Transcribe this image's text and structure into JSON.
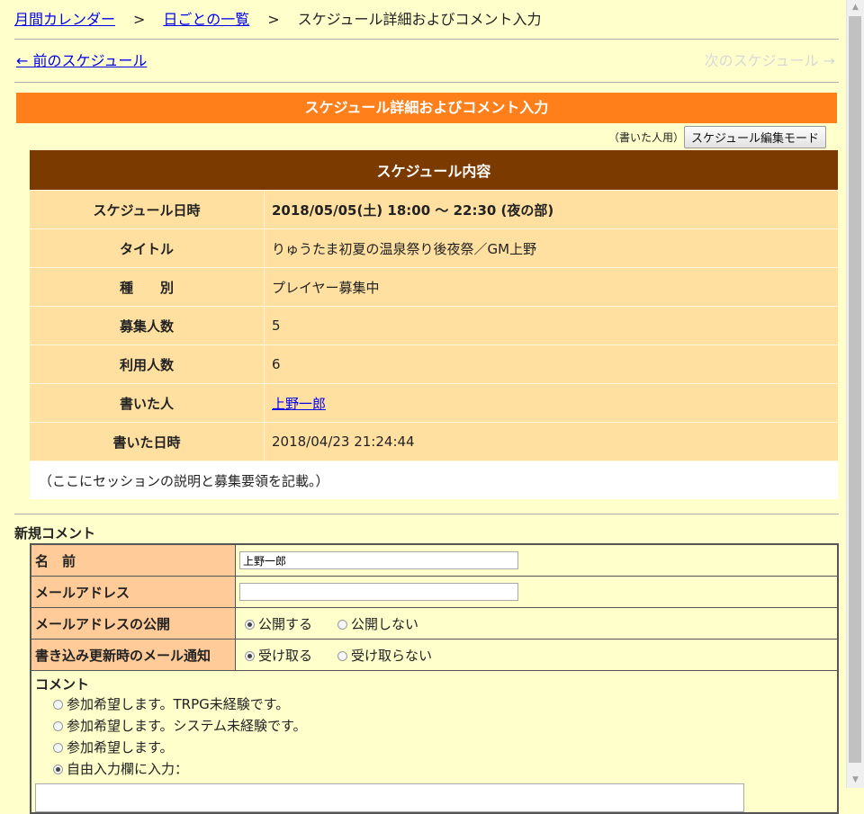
{
  "breadcrumb": {
    "monthly": "月間カレンダー",
    "sep1": ">",
    "daily": "日ごとの一覧",
    "sep2": ">",
    "current": "スケジュール詳細およびコメント入力"
  },
  "nav": {
    "prev": "← 前のスケジュール",
    "next": "次のスケジュール →"
  },
  "header_bar": "スケジュール詳細およびコメント入力",
  "edit": {
    "note": "（書いた人用）",
    "button": "スケジュール編集モード"
  },
  "schedule": {
    "heading": "スケジュール内容",
    "rows": [
      {
        "key": "スケジュール日時",
        "value": "2018/05/05(土) 18:00 ～ 22:30 (夜の部)"
      },
      {
        "key": "タイトル",
        "value": "りゅうたま初夏の温泉祭り後夜祭／GM上野"
      },
      {
        "key": "種　　別",
        "value": "プレイヤー募集中"
      },
      {
        "key": "募集人数",
        "value": "5"
      },
      {
        "key": "利用人数",
        "value": "6"
      },
      {
        "key": "書いた人",
        "value": "上野一郎"
      },
      {
        "key": "書いた日時",
        "value": "2018/04/23 21:24:44"
      }
    ],
    "description": "（ここにセッションの説明と募集要領を記載。）"
  },
  "comment_form": {
    "title": "新規コメント",
    "name_label": "名　前",
    "name_value": "上野一郎",
    "email_label": "メールアドレス",
    "email_value": "",
    "email_public_label": "メールアドレスの公開",
    "email_public_options": [
      "公開する",
      "公開しない"
    ],
    "notify_label": "書き込み更新時のメール通知",
    "notify_options": [
      "受け取る",
      "受け取らない"
    ],
    "comment_label": "コメント",
    "comment_options": [
      "参加希望します。TRPG未経験です。",
      "参加希望します。システム未経験です。",
      "参加希望します。",
      "自由入力欄に入力："
    ]
  }
}
